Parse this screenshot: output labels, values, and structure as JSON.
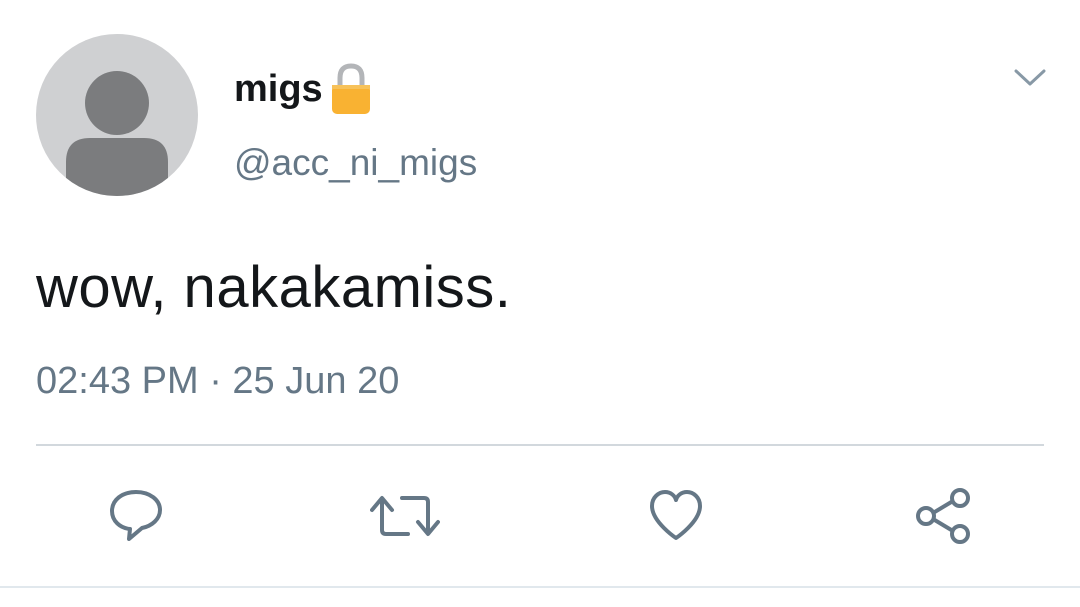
{
  "tweet": {
    "display_name": "migs",
    "handle": "@acc_ni_migs",
    "text": "wow, nakakamiss.",
    "timestamp": "02:43 PM · 25 Jun 20",
    "protected_icon": "lock-icon",
    "menu_icon": "chevron-down-icon"
  },
  "actions": [
    {
      "icon": "reply-icon"
    },
    {
      "icon": "retweet-icon"
    },
    {
      "icon": "like-icon"
    },
    {
      "icon": "share-icon"
    }
  ],
  "colors": {
    "text_primary": "#14171a",
    "text_secondary": "#657786",
    "icon": "#657786",
    "lock": "#f9b232",
    "avatar_bg": "#cfd0d2",
    "avatar_figure": "#7b7c7e"
  }
}
